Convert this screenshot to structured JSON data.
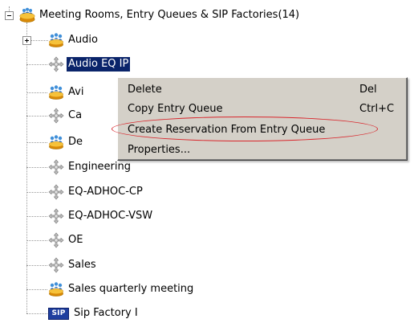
{
  "tree": {
    "root": {
      "label": "Meeting Rooms, Entry Queues & SIP Factories(14)",
      "icon": "meeting-rooms-group-icon"
    },
    "items": [
      {
        "label": "Audio",
        "icon": "meeting-room-icon",
        "expandable": true
      },
      {
        "label": "Audio EQ IP",
        "icon": "entry-queue-icon",
        "selected": true
      },
      {
        "label": "Avi",
        "icon": "meeting-room-icon"
      },
      {
        "label": "Ca",
        "icon": "entry-queue-icon"
      },
      {
        "label": "De",
        "icon": "meeting-room-icon"
      },
      {
        "label": "Engineering",
        "icon": "entry-queue-icon"
      },
      {
        "label": "EQ-ADHOC-CP",
        "icon": "entry-queue-icon"
      },
      {
        "label": "EQ-ADHOC-VSW",
        "icon": "entry-queue-icon"
      },
      {
        "label": "OE",
        "icon": "entry-queue-icon"
      },
      {
        "label": "Sales",
        "icon": "entry-queue-icon"
      },
      {
        "label": "Sales quarterly meeting",
        "icon": "meeting-room-icon"
      },
      {
        "label": "Sip Factory I",
        "icon": "sip-factory-icon",
        "badge": "SIP"
      }
    ]
  },
  "context_menu": {
    "items": [
      {
        "label": "Delete",
        "shortcut": "Del"
      },
      {
        "label": "Copy Entry Queue",
        "shortcut": "Ctrl+C"
      },
      {
        "label": "Create Reservation From Entry Queue",
        "shortcut": "",
        "highlighted_annotation": true
      },
      {
        "label": "Properties...",
        "shortcut": ""
      }
    ]
  },
  "colors": {
    "selection": "#0a246a",
    "annotation": "#d9262c",
    "menu_bg": "#d4d0c8"
  }
}
